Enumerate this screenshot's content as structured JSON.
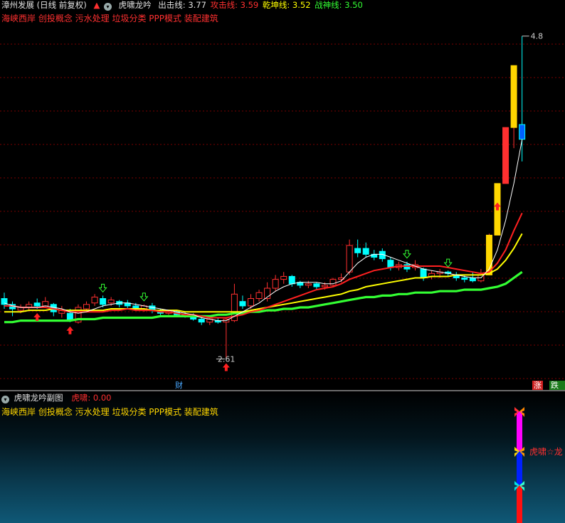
{
  "header": {
    "stock_name": "漳州发展",
    "period": "(日线 前复权)",
    "indicator_name": "虎啸龙吟",
    "lines": [
      {
        "label": "出击线",
        "value": "3.77",
        "color": "#e0e0e0"
      },
      {
        "label": "攻击线",
        "value": "3.59",
        "color": "#ff3030"
      },
      {
        "label": "乾坤线",
        "value": "3.52",
        "color": "#ffff00"
      },
      {
        "label": "战神线",
        "value": "3.50",
        "color": "#33ff33"
      }
    ]
  },
  "concepts": "海峡西岸 创投概念 污水处理 垃圾分类 PPP模式 装配建筑",
  "price_labels": {
    "high": "4.8",
    "low": "2.61"
  },
  "badges": {
    "cai": "财",
    "zhang": "涨",
    "dieting": "跌停"
  },
  "subchart": {
    "title": "虎啸龙吟副图",
    "label": "虎啸",
    "value": "0.00",
    "concepts": "海峡西岸 创投概念 污水处理 垃圾分类 PPP模式 装配建筑",
    "signal_text": "虎啸☆龙"
  },
  "colors": {
    "up": "#ff3030",
    "down": "#00ffff",
    "white_line": "#ffffff",
    "red_line": "#ff2020",
    "yellow_line": "#ffff00",
    "green_line": "#33ff33",
    "gold_bar": "#ffd700",
    "blue_bar": "#0060ff"
  },
  "chart_data": {
    "type": "candlestick",
    "note_unit": "price",
    "y_range": [
      2.4,
      4.9
    ],
    "candles": [
      {
        "o": 3.02,
        "c": 2.98,
        "h": 3.06,
        "l": 2.95
      },
      {
        "o": 2.98,
        "c": 2.95,
        "h": 3.0,
        "l": 2.9
      },
      {
        "o": 2.94,
        "c": 2.96,
        "h": 2.98,
        "l": 2.92
      },
      {
        "o": 2.96,
        "c": 2.98,
        "h": 3.0,
        "l": 2.94
      },
      {
        "o": 2.99,
        "c": 2.97,
        "h": 3.02,
        "l": 2.95
      },
      {
        "o": 2.97,
        "c": 3.0,
        "h": 3.03,
        "l": 2.96
      },
      {
        "o": 2.98,
        "c": 2.93,
        "h": 2.99,
        "l": 2.9
      },
      {
        "o": 2.92,
        "c": 2.94,
        "h": 2.97,
        "l": 2.89
      },
      {
        "o": 2.92,
        "c": 2.88,
        "h": 2.95,
        "l": 2.86
      },
      {
        "o": 2.86,
        "c": 2.96,
        "h": 2.98,
        "l": 2.85
      },
      {
        "o": 2.95,
        "c": 2.98,
        "h": 3.0,
        "l": 2.93
      },
      {
        "o": 2.99,
        "c": 3.03,
        "h": 3.05,
        "l": 2.97
      },
      {
        "o": 3.02,
        "c": 2.98,
        "h": 3.04,
        "l": 2.96
      },
      {
        "o": 2.99,
        "c": 3.01,
        "h": 3.03,
        "l": 2.97
      },
      {
        "o": 3.0,
        "c": 2.98,
        "h": 3.01,
        "l": 2.96
      },
      {
        "o": 2.99,
        "c": 2.97,
        "h": 3.01,
        "l": 2.95
      },
      {
        "o": 2.97,
        "c": 2.95,
        "h": 2.99,
        "l": 2.94
      },
      {
        "o": 2.95,
        "c": 2.97,
        "h": 2.98,
        "l": 2.93
      },
      {
        "o": 2.97,
        "c": 2.94,
        "h": 2.99,
        "l": 2.92
      },
      {
        "o": 2.94,
        "c": 2.92,
        "h": 2.95,
        "l": 2.9
      },
      {
        "o": 2.92,
        "c": 2.93,
        "h": 2.94,
        "l": 2.91
      },
      {
        "o": 2.93,
        "c": 2.91,
        "h": 2.94,
        "l": 2.9
      },
      {
        "o": 2.91,
        "c": 2.9,
        "h": 2.93,
        "l": 2.89
      },
      {
        "o": 2.9,
        "c": 2.88,
        "h": 2.92,
        "l": 2.87
      },
      {
        "o": 2.88,
        "c": 2.86,
        "h": 2.9,
        "l": 2.84
      },
      {
        "o": 2.86,
        "c": 2.88,
        "h": 2.89,
        "l": 2.84
      },
      {
        "o": 2.87,
        "c": 2.86,
        "h": 2.89,
        "l": 2.85
      },
      {
        "o": 2.86,
        "c": 2.88,
        "h": 2.89,
        "l": 2.61
      },
      {
        "o": 2.87,
        "c": 3.05,
        "h": 3.12,
        "l": 2.86
      },
      {
        "o": 3.0,
        "c": 2.97,
        "h": 3.04,
        "l": 2.95
      },
      {
        "o": 2.97,
        "c": 3.02,
        "h": 3.05,
        "l": 2.95
      },
      {
        "o": 3.02,
        "c": 3.06,
        "h": 3.08,
        "l": 3.0
      },
      {
        "o": 3.02,
        "c": 3.09,
        "h": 3.13,
        "l": 3.0
      },
      {
        "o": 3.09,
        "c": 3.15,
        "h": 3.18,
        "l": 3.07
      },
      {
        "o": 3.15,
        "c": 3.17,
        "h": 3.2,
        "l": 3.12
      },
      {
        "o": 3.17,
        "c": 3.12,
        "h": 3.18,
        "l": 3.1
      },
      {
        "o": 3.13,
        "c": 3.11,
        "h": 3.14,
        "l": 3.09
      },
      {
        "o": 3.11,
        "c": 3.12,
        "h": 3.14,
        "l": 3.09
      },
      {
        "o": 3.12,
        "c": 3.1,
        "h": 3.13,
        "l": 3.08
      },
      {
        "o": 3.1,
        "c": 3.11,
        "h": 3.13,
        "l": 3.08
      },
      {
        "o": 3.11,
        "c": 3.15,
        "h": 3.16,
        "l": 3.1
      },
      {
        "o": 3.15,
        "c": 3.16,
        "h": 3.19,
        "l": 3.13
      },
      {
        "o": 3.2,
        "c": 3.38,
        "h": 3.42,
        "l": 3.18
      },
      {
        "o": 3.36,
        "c": 3.33,
        "h": 3.42,
        "l": 3.3
      },
      {
        "o": 3.36,
        "c": 3.32,
        "h": 3.4,
        "l": 3.3
      },
      {
        "o": 3.32,
        "c": 3.3,
        "h": 3.35,
        "l": 3.28
      },
      {
        "o": 3.34,
        "c": 3.29,
        "h": 3.36,
        "l": 3.27
      },
      {
        "o": 3.28,
        "c": 3.23,
        "h": 3.3,
        "l": 3.21
      },
      {
        "o": 3.23,
        "c": 3.25,
        "h": 3.27,
        "l": 3.21
      },
      {
        "o": 3.25,
        "c": 3.22,
        "h": 3.27,
        "l": 3.2
      },
      {
        "o": 3.23,
        "c": 3.25,
        "h": 3.28,
        "l": 3.21
      },
      {
        "o": 3.22,
        "c": 3.16,
        "h": 3.23,
        "l": 3.14
      },
      {
        "o": 3.17,
        "c": 3.19,
        "h": 3.21,
        "l": 3.15
      },
      {
        "o": 3.19,
        "c": 3.2,
        "h": 3.22,
        "l": 3.16
      },
      {
        "o": 3.2,
        "c": 3.19,
        "h": 3.21,
        "l": 3.17
      },
      {
        "o": 3.18,
        "c": 3.16,
        "h": 3.2,
        "l": 3.14
      },
      {
        "o": 3.16,
        "c": 3.15,
        "h": 3.18,
        "l": 3.13
      },
      {
        "o": 3.16,
        "c": 3.14,
        "h": 3.2,
        "l": 3.13
      },
      {
        "o": 3.14,
        "c": 3.18,
        "h": 3.22,
        "l": 3.13
      },
      {
        "o": 3.18,
        "c": 3.45,
        "h": 3.46,
        "l": 3.18
      },
      {
        "o": 3.45,
        "c": 3.8,
        "h": 3.8,
        "l": 3.7
      },
      {
        "o": 3.8,
        "c": 4.18,
        "h": 4.18,
        "l": 3.86
      },
      {
        "o": 4.18,
        "c": 4.6,
        "h": 4.6,
        "l": 4.04
      },
      {
        "o": 4.2,
        "c": 4.1,
        "h": 4.8,
        "l": 3.95
      }
    ],
    "candle_styles": [
      "d",
      "d",
      "u",
      "u",
      "d",
      "u",
      "d",
      "u",
      "d",
      "u",
      "u",
      "u",
      "d",
      "u",
      "d",
      "d",
      "d",
      "u",
      "d",
      "d",
      "u",
      "d",
      "d",
      "d",
      "d",
      "u",
      "d",
      "u",
      "u",
      "d",
      "u",
      "u",
      "u",
      "u",
      "u",
      "d",
      "d",
      "u",
      "d",
      "u",
      "u",
      "u",
      "u",
      "d",
      "d",
      "d",
      "d",
      "d",
      "u",
      "d",
      "u",
      "d",
      "u",
      "u",
      "d",
      "d",
      "d",
      "d",
      "u",
      "Y",
      "Y",
      "r",
      "Y",
      "b"
    ],
    "lines": {
      "white": [
        2.99,
        2.97,
        2.96,
        2.96,
        2.96,
        2.97,
        2.96,
        2.95,
        2.93,
        2.92,
        2.93,
        2.95,
        2.97,
        2.98,
        2.99,
        2.99,
        2.98,
        2.97,
        2.96,
        2.95,
        2.94,
        2.93,
        2.92,
        2.91,
        2.89,
        2.88,
        2.87,
        2.87,
        2.9,
        2.93,
        2.96,
        2.99,
        3.03,
        3.07,
        3.1,
        3.12,
        3.13,
        3.13,
        3.13,
        3.12,
        3.12,
        3.14,
        3.2,
        3.26,
        3.3,
        3.32,
        3.32,
        3.3,
        3.28,
        3.26,
        3.24,
        3.22,
        3.21,
        3.2,
        3.19,
        3.18,
        3.17,
        3.16,
        3.16,
        3.22,
        3.35,
        3.55,
        3.8,
        4.1
      ],
      "red": [
        2.97,
        2.97,
        2.96,
        2.96,
        2.96,
        2.96,
        2.95,
        2.94,
        2.93,
        2.93,
        2.93,
        2.93,
        2.93,
        2.94,
        2.94,
        2.95,
        2.94,
        2.94,
        2.94,
        2.93,
        2.93,
        2.92,
        2.91,
        2.91,
        2.9,
        2.89,
        2.89,
        2.89,
        2.9,
        2.91,
        2.93,
        2.94,
        2.96,
        2.98,
        3.0,
        3.02,
        3.04,
        3.06,
        3.08,
        3.09,
        3.1,
        3.12,
        3.15,
        3.17,
        3.19,
        3.21,
        3.22,
        3.23,
        3.24,
        3.24,
        3.24,
        3.24,
        3.24,
        3.24,
        3.23,
        3.22,
        3.21,
        3.2,
        3.19,
        3.2,
        3.26,
        3.35,
        3.48,
        3.6
      ],
      "yellow": [
        2.93,
        2.93,
        2.93,
        2.94,
        2.94,
        2.94,
        2.95,
        2.94,
        2.94,
        2.94,
        2.94,
        2.94,
        2.94,
        2.95,
        2.95,
        2.95,
        2.95,
        2.95,
        2.94,
        2.94,
        2.94,
        2.94,
        2.93,
        2.93,
        2.93,
        2.93,
        2.93,
        2.93,
        2.93,
        2.93,
        2.94,
        2.95,
        2.96,
        2.97,
        2.98,
        2.99,
        3.0,
        3.01,
        3.02,
        3.03,
        3.04,
        3.05,
        3.07,
        3.08,
        3.1,
        3.11,
        3.12,
        3.13,
        3.14,
        3.15,
        3.16,
        3.16,
        3.17,
        3.17,
        3.17,
        3.18,
        3.18,
        3.18,
        3.18,
        3.19,
        3.22,
        3.28,
        3.36,
        3.46
      ],
      "green": [
        2.86,
        2.86,
        2.87,
        2.87,
        2.87,
        2.87,
        2.87,
        2.87,
        2.87,
        2.88,
        2.88,
        2.88,
        2.89,
        2.89,
        2.89,
        2.89,
        2.89,
        2.89,
        2.89,
        2.9,
        2.9,
        2.9,
        2.9,
        2.9,
        2.9,
        2.9,
        2.91,
        2.91,
        2.92,
        2.92,
        2.93,
        2.93,
        2.94,
        2.94,
        2.95,
        2.95,
        2.96,
        2.96,
        2.97,
        2.98,
        2.99,
        3.0,
        3.01,
        3.02,
        3.03,
        3.03,
        3.04,
        3.04,
        3.05,
        3.05,
        3.06,
        3.06,
        3.06,
        3.07,
        3.07,
        3.07,
        3.08,
        3.08,
        3.08,
        3.09,
        3.1,
        3.12,
        3.16,
        3.2
      ]
    },
    "signals": [
      {
        "i": 4,
        "type": "up-red"
      },
      {
        "i": 8,
        "type": "up-red"
      },
      {
        "i": 12,
        "type": "down-green"
      },
      {
        "i": 17,
        "type": "down-green"
      },
      {
        "i": 27,
        "type": "up-red"
      },
      {
        "i": 49,
        "type": "down-green"
      },
      {
        "i": 54,
        "type": "down-green"
      },
      {
        "i": 60,
        "type": "up-red"
      }
    ]
  }
}
